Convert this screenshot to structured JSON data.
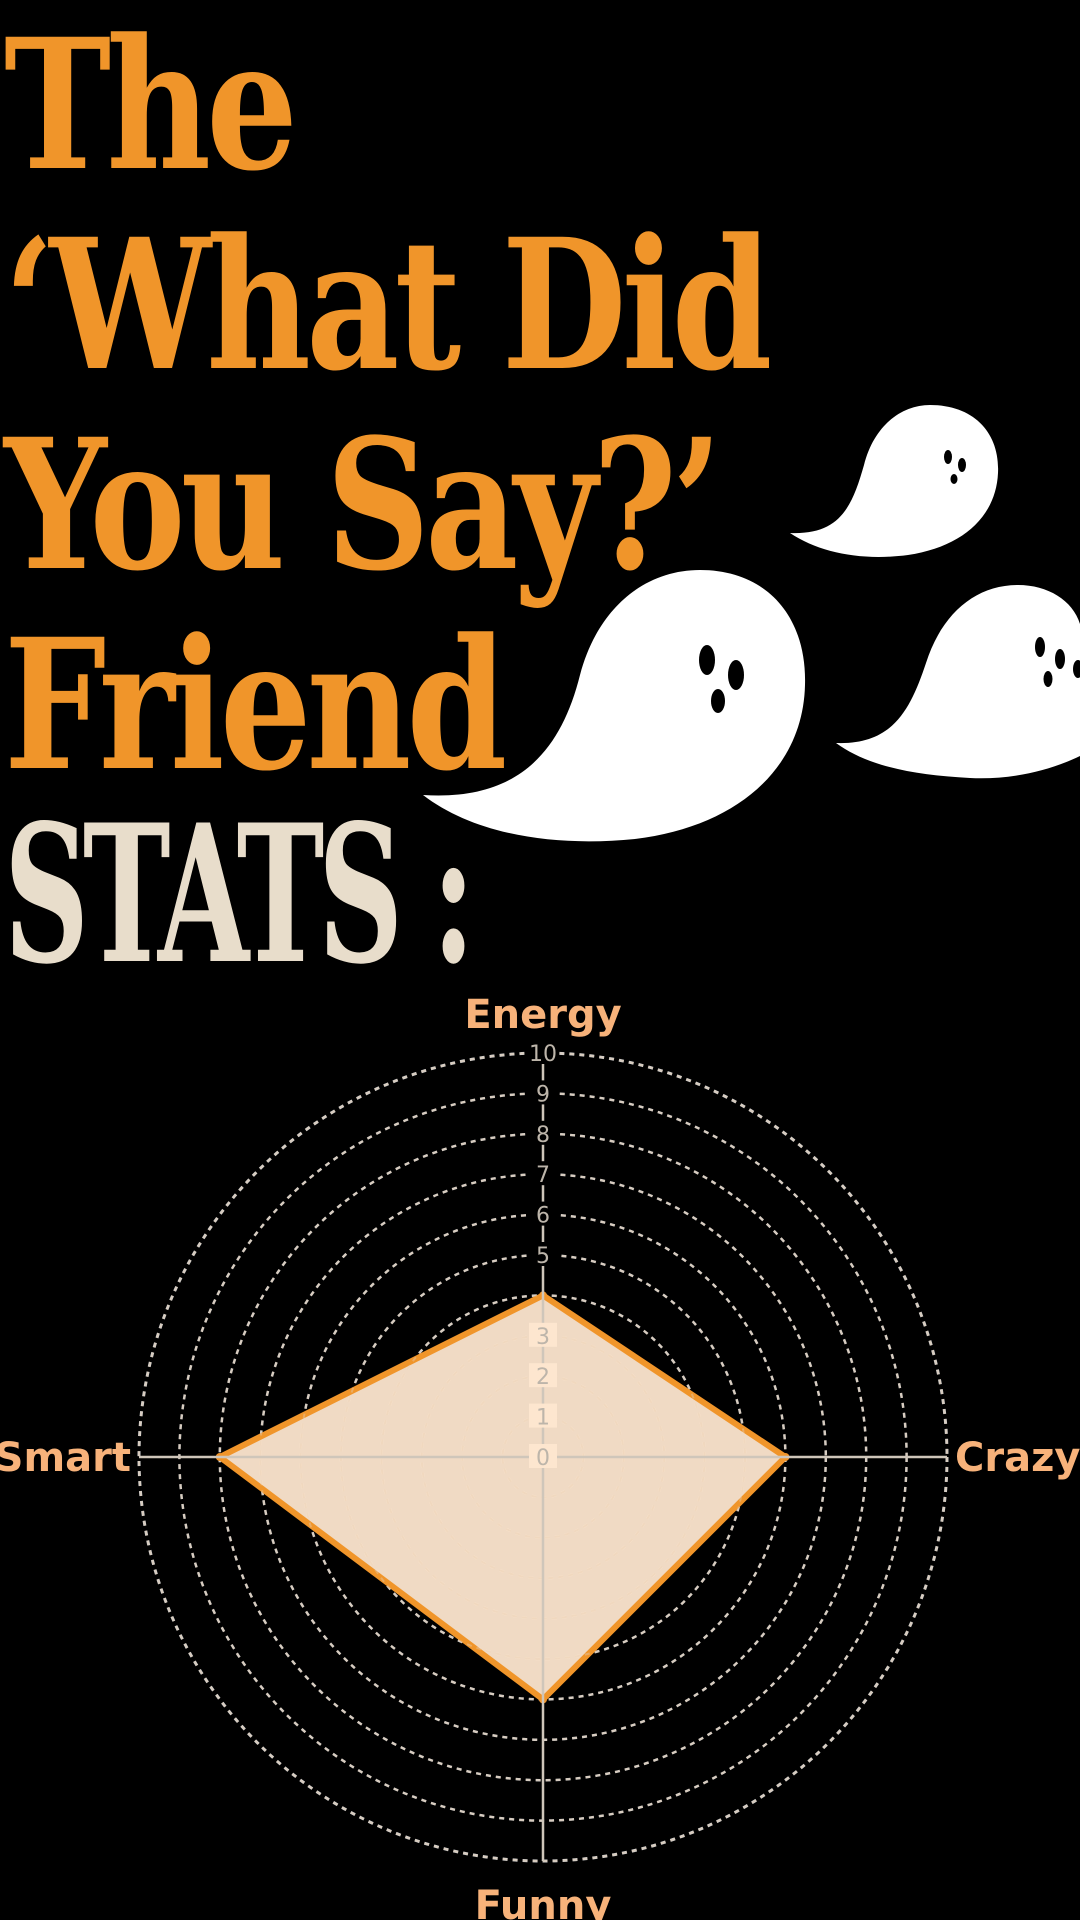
{
  "title": {
    "lines": [
      "The",
      "‘What Did",
      "You Say?’",
      "Friend"
    ],
    "stats": "STATS :"
  },
  "icons": [
    "ghost-icon",
    "ghost-icon",
    "ghost-icon"
  ],
  "colors": {
    "background": "#000000",
    "title": "#F0952A",
    "stats": "#E8DDCB",
    "fill": "#FDE6CF",
    "outline": "#F0952A",
    "axis_labels": "#F7B27A",
    "grid": "#cfcfcf"
  },
  "chart_data": {
    "type": "radar",
    "axes": [
      "Energy",
      "Crazy",
      "Funny",
      "Smart"
    ],
    "values": [
      4,
      6,
      6,
      8
    ],
    "rlim": [
      0,
      10
    ],
    "ticks": [
      "0",
      "1",
      "2",
      "3",
      "",
      "5",
      "6",
      "7",
      "8",
      "9",
      "10"
    ],
    "grid": true
  }
}
